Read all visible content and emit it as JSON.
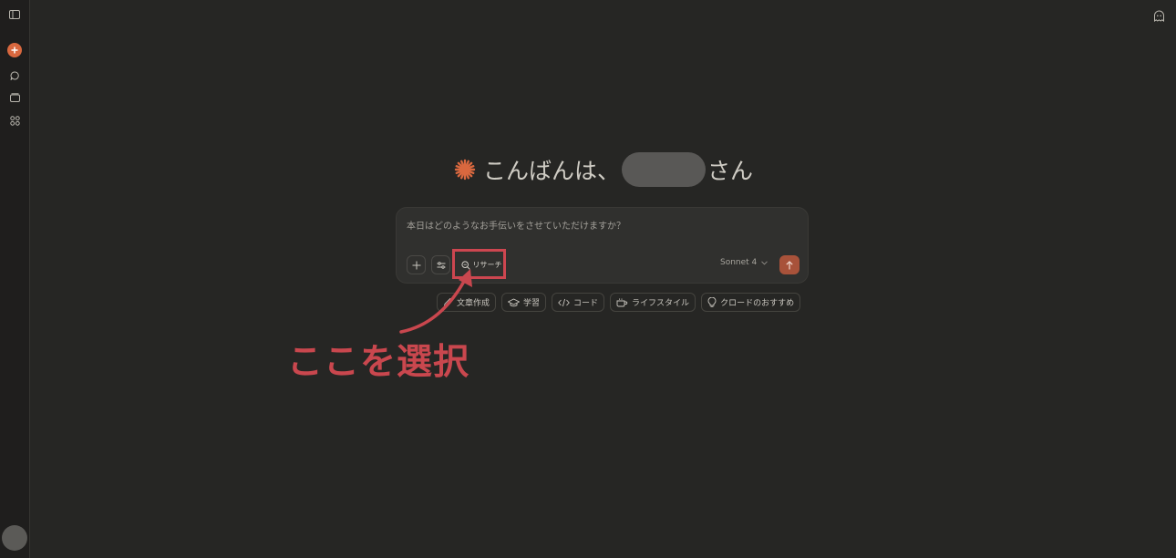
{
  "greeting": {
    "prefix": "こんばんは、",
    "suffix": "さん"
  },
  "composer": {
    "placeholder": "本日はどのようなお手伝いをさせていただけますか？",
    "research_label": "リサーチ",
    "model_label": "Sonnet 4"
  },
  "chips": [
    {
      "label": "文章作成",
      "icon": "pencil-icon"
    },
    {
      "label": "学習",
      "icon": "graduation-cap-icon"
    },
    {
      "label": "コード",
      "icon": "code-icon"
    },
    {
      "label": "ライフスタイル",
      "icon": "coffee-icon"
    },
    {
      "label": "クロードのおすすめ",
      "icon": "lightbulb-icon"
    }
  ],
  "annotation": {
    "label": "ここを選択",
    "color": "#c9474e"
  },
  "colors": {
    "background": "#262624",
    "sidebar": "#1f1e1d",
    "accent": "#d9683f",
    "send_button": "#a8523a"
  },
  "icons": {
    "sidebar_toggle": "sidebar-toggle-icon",
    "new_chat": "plus-icon",
    "chats": "chat-bubble-icon",
    "projects": "folder-icon",
    "artifacts": "grid-icon",
    "incognito": "ghost-icon",
    "greeting": "asterisk-spark-icon"
  }
}
